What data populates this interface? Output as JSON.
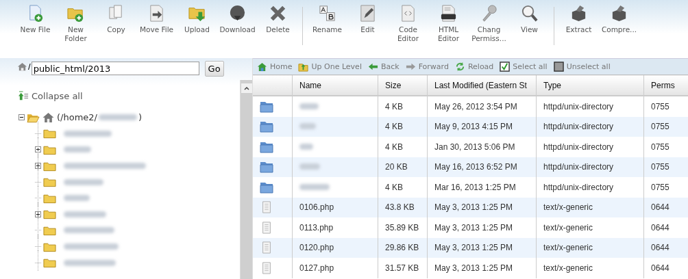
{
  "toolbar": [
    [
      {
        "kind": "newfile",
        "label": "New File"
      },
      {
        "kind": "newfolder",
        "label": "New\nFolder"
      },
      {
        "kind": "copy",
        "label": "Copy"
      },
      {
        "kind": "move",
        "label": "Move File"
      },
      {
        "kind": "upload",
        "label": "Upload"
      },
      {
        "kind": "download",
        "label": "Download"
      },
      {
        "kind": "delete",
        "label": "Delete"
      }
    ],
    [
      {
        "kind": "rename",
        "label": "Rename"
      },
      {
        "kind": "edit",
        "label": "Edit"
      },
      {
        "kind": "code",
        "label": "Code\nEditor"
      },
      {
        "kind": "html",
        "label": "HTML\nEditor"
      },
      {
        "kind": "permissions",
        "label": "Chang\nPermiss..."
      },
      {
        "kind": "view",
        "label": "View"
      }
    ],
    [
      {
        "kind": "extract",
        "label": "Extract"
      },
      {
        "kind": "compress",
        "label": "Compre..."
      }
    ]
  ],
  "path": {
    "separator": "/",
    "value": "public_html/2013",
    "button": "Go"
  },
  "tree": {
    "collapse_all": "Collapse all",
    "root": {
      "prefix": "(/home2/",
      "suffix": ")",
      "expanded": true,
      "children": [
        {
          "expandable": false
        },
        {
          "expandable": true
        },
        {
          "expandable": true
        },
        {
          "expandable": false
        },
        {
          "expandable": false
        },
        {
          "expandable": true
        },
        {
          "expandable": false
        },
        {
          "expandable": false
        },
        {
          "expandable": false
        }
      ]
    }
  },
  "nav": [
    {
      "kind": "home",
      "label": "Home"
    },
    {
      "kind": "up",
      "label": "Up One Level"
    },
    {
      "kind": "back",
      "label": "Back"
    },
    {
      "kind": "forward",
      "label": "Forward"
    },
    {
      "kind": "reload",
      "label": "Reload"
    },
    {
      "kind": "selectall",
      "label": "Select all"
    },
    {
      "kind": "unselectall",
      "label": "Unselect all"
    }
  ],
  "table": {
    "columns": [
      "Name",
      "Size",
      "Last Modified (Eastern St",
      "Type",
      "Perms"
    ],
    "rows": [
      {
        "kind": "folder",
        "size": "4 KB",
        "modified": "May 26, 2012 3:54 PM",
        "type": "httpd/unix-directory",
        "perms": "0755"
      },
      {
        "kind": "folder",
        "size": "4 KB",
        "modified": "May 9, 2013 4:15 PM",
        "type": "httpd/unix-directory",
        "perms": "0755"
      },
      {
        "kind": "folder",
        "size": "4 KB",
        "modified": "Jan 30, 2013 5:06 PM",
        "type": "httpd/unix-directory",
        "perms": "0755"
      },
      {
        "kind": "folder",
        "size": "20 KB",
        "modified": "May 16, 2013 6:52 PM",
        "type": "httpd/unix-directory",
        "perms": "0755"
      },
      {
        "kind": "folder",
        "size": "4 KB",
        "modified": "Mar 16, 2013 1:25 PM",
        "type": "httpd/unix-directory",
        "perms": "0755"
      },
      {
        "kind": "file",
        "name": "0106.php",
        "size": "43.8 KB",
        "modified": "May 3, 2013 1:25 PM",
        "type": "text/x-generic",
        "perms": "0644"
      },
      {
        "kind": "file",
        "name": "0113.php",
        "size": "35.89 KB",
        "modified": "May 3, 2013 1:25 PM",
        "type": "text/x-generic",
        "perms": "0644"
      },
      {
        "kind": "file",
        "name": "0120.php",
        "size": "29.86 KB",
        "modified": "May 3, 2013 1:25 PM",
        "type": "text/x-generic",
        "perms": "0644"
      },
      {
        "kind": "file",
        "name": "0127.php",
        "size": "31.57 KB",
        "modified": "May 3, 2013 1:25 PM",
        "type": "text/x-generic",
        "perms": "0644"
      }
    ]
  }
}
